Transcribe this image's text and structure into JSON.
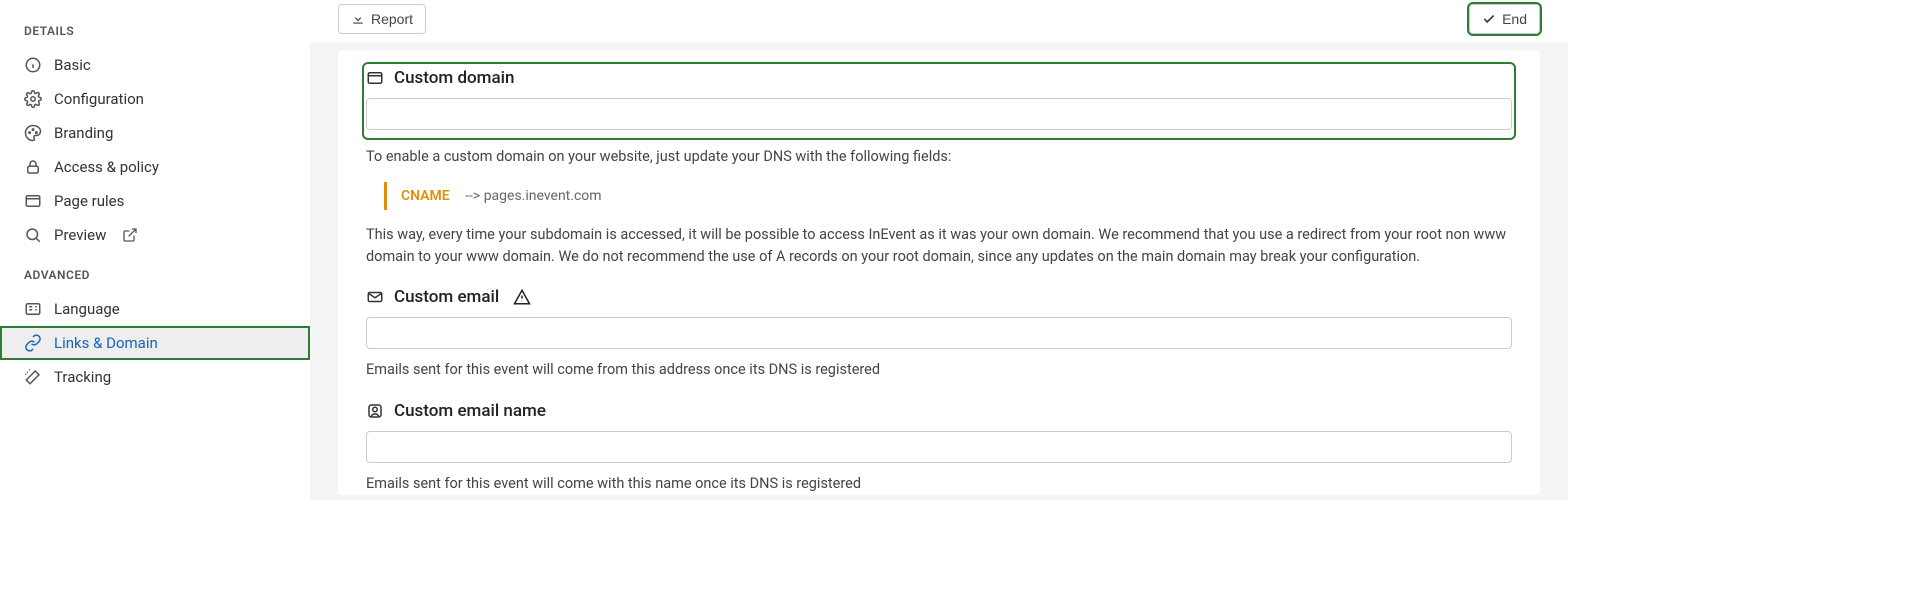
{
  "topbar": {
    "report_label": "Report",
    "end_label": "End"
  },
  "sidebar": {
    "section_details": "DETAILS",
    "section_advanced": "ADVANCED",
    "items_details": [
      {
        "label": "Basic"
      },
      {
        "label": "Configuration"
      },
      {
        "label": "Branding"
      },
      {
        "label": "Access & policy"
      },
      {
        "label": "Page rules"
      },
      {
        "label": "Preview"
      }
    ],
    "items_advanced": [
      {
        "label": "Language"
      },
      {
        "label": "Links & Domain"
      },
      {
        "label": "Tracking"
      }
    ]
  },
  "main": {
    "custom_domain": {
      "title": "Custom domain",
      "help_intro": "To enable a custom domain on your website, just update your DNS with the following fields:",
      "cname_label": "CNAME",
      "cname_target": "-->  pages.inevent.com",
      "help_body": "This way, every time your subdomain is accessed, it will be possible to access InEvent as it was your own domain. We recommend that you use a redirect from your root non www domain to your www domain. We do not recommend the use of A records on your root domain, since any updates on the main domain may break your configuration."
    },
    "custom_email": {
      "title": "Custom email",
      "help": "Emails sent for this event will come from this address once its DNS is registered"
    },
    "custom_email_name": {
      "title": "Custom email name",
      "help": "Emails sent for this event will come with this name once its DNS is registered"
    }
  }
}
